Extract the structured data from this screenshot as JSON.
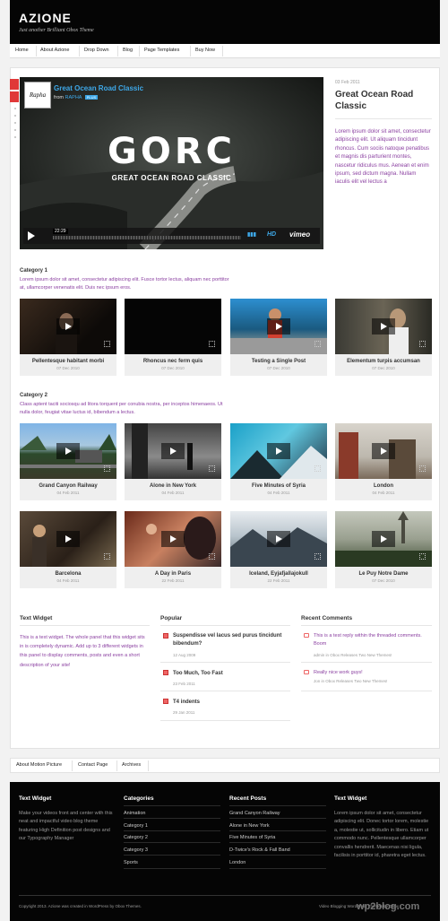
{
  "site": {
    "logo": "AZIONE",
    "tagline": "Just another Brilliant Obox Theme"
  },
  "nav": [
    "Home",
    "About Azione",
    "Drop Down",
    "Blog",
    "Page Templates",
    "Buy Now"
  ],
  "feature": {
    "video_title": "Great Ocean Road Classic",
    "from_label": "from",
    "author": "RAPHA",
    "plus_badge": "PLUS",
    "badge_text": "Rapha",
    "big_title": "GORC",
    "subtitle": "GREAT OCEAN ROAD CLASSIC",
    "time": "22:29",
    "hd_label": "HD",
    "vimeo_label": "vimeo",
    "date": "03 Feb 2011",
    "title": "Great Ocean Road Classic",
    "excerpt": "Lorem ipsum dolor sit amet, consectetur adipiscing elit. Ut aliquam tincidunt rhoncus. Cum sociis natoque penatibus et magnis dis parturient montes, nascetur ridiculus mus. Aenean et enim ipsum, sed dictum magna. Nullam iaculis elit vel lectus a"
  },
  "category1": {
    "title": "Category 1",
    "desc": "Lorem ipsum dolor sit amet, consectetur adipiscing elit. Fusce tortor lectus, aliquam nec porttitor at, ullamcorper venenatis elit. Duis nec ipsum eros.",
    "items": [
      {
        "title": "Pellentesque habitant morbi",
        "date": "07 Dec 2010"
      },
      {
        "title": "Rhoncus nec ferm quis",
        "date": "07 Dec 2010"
      },
      {
        "title": "Testing a Single Post",
        "date": "07 Dec 2010"
      },
      {
        "title": "Elementum turpis accumsan",
        "date": "07 Dec 2010"
      }
    ]
  },
  "category2": {
    "title": "Category 2",
    "desc": "Class aptent taciti sociosqu ad litora torquent per conubia nostra, per inceptos himenaeos. Ut nulla dolor, feugiat vitae luctus id, bibendum a lectus.",
    "items": [
      {
        "title": "Grand Canyon Railway",
        "date": "04 Feb 2011"
      },
      {
        "title": "Alone in New York",
        "date": "04 Feb 2011"
      },
      {
        "title": "Five Minutes of Syria",
        "date": "04 Feb 2011"
      },
      {
        "title": "London",
        "date": "04 Feb 2011"
      },
      {
        "title": "Barcelona",
        "date": "04 Feb 2011"
      },
      {
        "title": "A Day in Paris",
        "date": "22 Feb 2011"
      },
      {
        "title": "Iceland, Eyjafjallajokull",
        "date": "22 Feb 2011"
      },
      {
        "title": "Le Puy Notre Dame",
        "date": "07 Dec 2010"
      }
    ]
  },
  "text_widget": {
    "title": "Text Widget",
    "body": "This is a text widget. The whole panel that this widget sits in is completely dynamic. Add up to 3 different widgets in this panel to display comments, posts and even a short description of your site!"
  },
  "popular": {
    "title": "Popular",
    "items": [
      {
        "title": "Suspendisse vel lacus sed purus tincidunt bibendum?",
        "date": "12 Aug 2009"
      },
      {
        "title": "Too Much, Too Fast",
        "date": "23 Feb 2011"
      },
      {
        "title": "T4 indents",
        "date": "29 Jan 2011"
      }
    ]
  },
  "recent_comments": {
    "title": "Recent Comments",
    "items": [
      {
        "text": "This is a test reply within the threaded comments. Boom",
        "by": "admin in Obox Releases Two New Themes!"
      },
      {
        "text": "Really nice work guys!",
        "by": "Jon in Obox Releases Two New Themes!"
      }
    ]
  },
  "footer_nav": [
    "About Motion Picture",
    "Contact Page",
    "Archives"
  ],
  "footer": {
    "col1": {
      "title": "Text Widget",
      "body": "Make your videos front and center with this neat and impactful video blog theme featuring High Definition post designs and our Typography Manager"
    },
    "col2": {
      "title": "Categories",
      "links": [
        "Animation",
        "Category 1",
        "Category 2",
        "Category 3",
        "Sports"
      ]
    },
    "col3": {
      "title": "Recent Posts",
      "links": [
        "Grand Canyon Railway",
        "Alone in New York",
        "Five Minutes of Syria",
        "D-Twice's Rock & Fall Band",
        "London"
      ]
    },
    "col4": {
      "title": "Text Widget",
      "body": "Lorem ipsum dolor sit amet, consectetur adipiscing elit. Donec tortor lorem, molestie a, molestie ut, sollicitudin in libero. Etiam ut commodo nunc. Pellentesque ullamcorper convallis hendrerit. Maecenas nisi ligula, facilisis in porttitor id, pharetra eget lectus."
    },
    "copyright": "Copyright 2013. Azione was created in WordPress by Obox Themes.",
    "credit": "Video Blogging WordPress Themes by Obox"
  },
  "watermark": "wp2blog.com"
}
